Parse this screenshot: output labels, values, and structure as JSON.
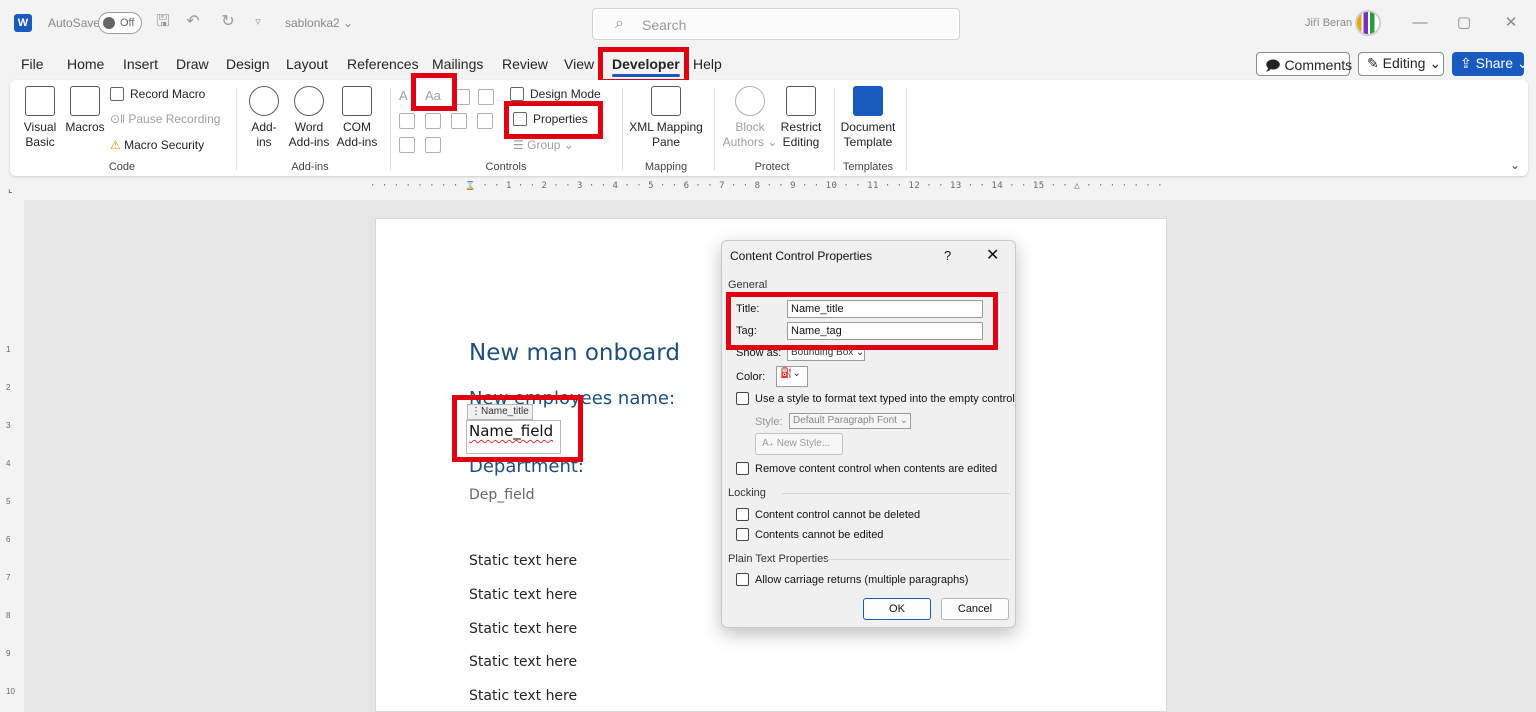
{
  "titlebar": {
    "app_logo": "W",
    "autosave_label": "AutoSave",
    "autosave_state": "Off",
    "doc_name": "sablonka2",
    "search_placeholder": "Search",
    "user_name": "Jiří Beran",
    "icons": [
      "save-icon",
      "undo-icon",
      "redo-icon",
      "customize-icon"
    ]
  },
  "menu": {
    "tabs": [
      "File",
      "Home",
      "Insert",
      "Draw",
      "Design",
      "Layout",
      "References",
      "Mailings",
      "Review",
      "View",
      "Developer",
      "Help"
    ],
    "active_tab": "Developer",
    "comments_label": "Comments",
    "editing_label": "Editing",
    "share_label": "Share"
  },
  "ribbon": {
    "code": {
      "label": "Code",
      "visual_basic": [
        "Visual",
        "Basic"
      ],
      "macros": "Macros",
      "record_macro": "Record Macro",
      "pause_recording": "Pause Recording",
      "macro_security": "Macro Security"
    },
    "addins": {
      "label": "Add-ins",
      "addins": [
        "Add-",
        "ins"
      ],
      "word_addins": [
        "Word",
        "Add-ins"
      ],
      "com_addins": [
        "COM",
        "Add-ins"
      ]
    },
    "controls": {
      "label": "Controls",
      "design_mode": "Design Mode",
      "properties": "Properties",
      "group": "Group"
    },
    "mapping": {
      "label": "Mapping",
      "xml_mapping": [
        "XML Mapping",
        "Pane"
      ]
    },
    "protect": {
      "label": "Protect",
      "block_authors": [
        "Block",
        "Authors"
      ],
      "restrict_editing": [
        "Restrict",
        "Editing"
      ]
    },
    "templates": {
      "label": "Templates",
      "document_template": [
        "Document",
        "Template"
      ]
    }
  },
  "ruler": {
    "numbers": [
      "1",
      "2",
      "3",
      "4",
      "5",
      "6",
      "7",
      "8",
      "9",
      "10",
      "11",
      "12",
      "13",
      "14",
      "15"
    ],
    "vertical_numbers": [
      "1",
      "2",
      "3",
      "4",
      "5",
      "6",
      "7",
      "8",
      "9",
      "10"
    ]
  },
  "document": {
    "heading": "New man onboard",
    "employee_label": "New employees name:",
    "control_title": "Name_title",
    "control_value": "Name_field",
    "department_label": "Department:",
    "department_value": "Dep_field",
    "static_lines": [
      "Static text here",
      "Static text here",
      "Static text here",
      "Static text here",
      "Static text here"
    ]
  },
  "dialog": {
    "title": "Content Control Properties",
    "help": "?",
    "close": "✕",
    "general_label": "General",
    "title_label": "Title:",
    "title_value": "Name_title",
    "tag_label": "Tag:",
    "tag_value": "Name_tag",
    "show_as_label": "Show as:",
    "show_as_value": "Bounding Box",
    "color_label": "Color:",
    "use_style_label": "Use a style to format text typed into the empty control",
    "style_label": "Style:",
    "style_value": "Default Paragraph Font",
    "new_style_label": "New Style...",
    "remove_control_label": "Remove content control when contents are edited",
    "locking_label": "Locking",
    "cannot_delete_label": "Content control cannot be deleted",
    "cannot_edit_label": "Contents cannot be edited",
    "plain_text_label": "Plain Text Properties",
    "allow_returns_label": "Allow carriage returns (multiple paragraphs)",
    "ok_label": "OK",
    "cancel_label": "Cancel"
  },
  "colors": {
    "accent": "#185abd",
    "highlight": "#e00012",
    "heading": "#1f4e79"
  }
}
